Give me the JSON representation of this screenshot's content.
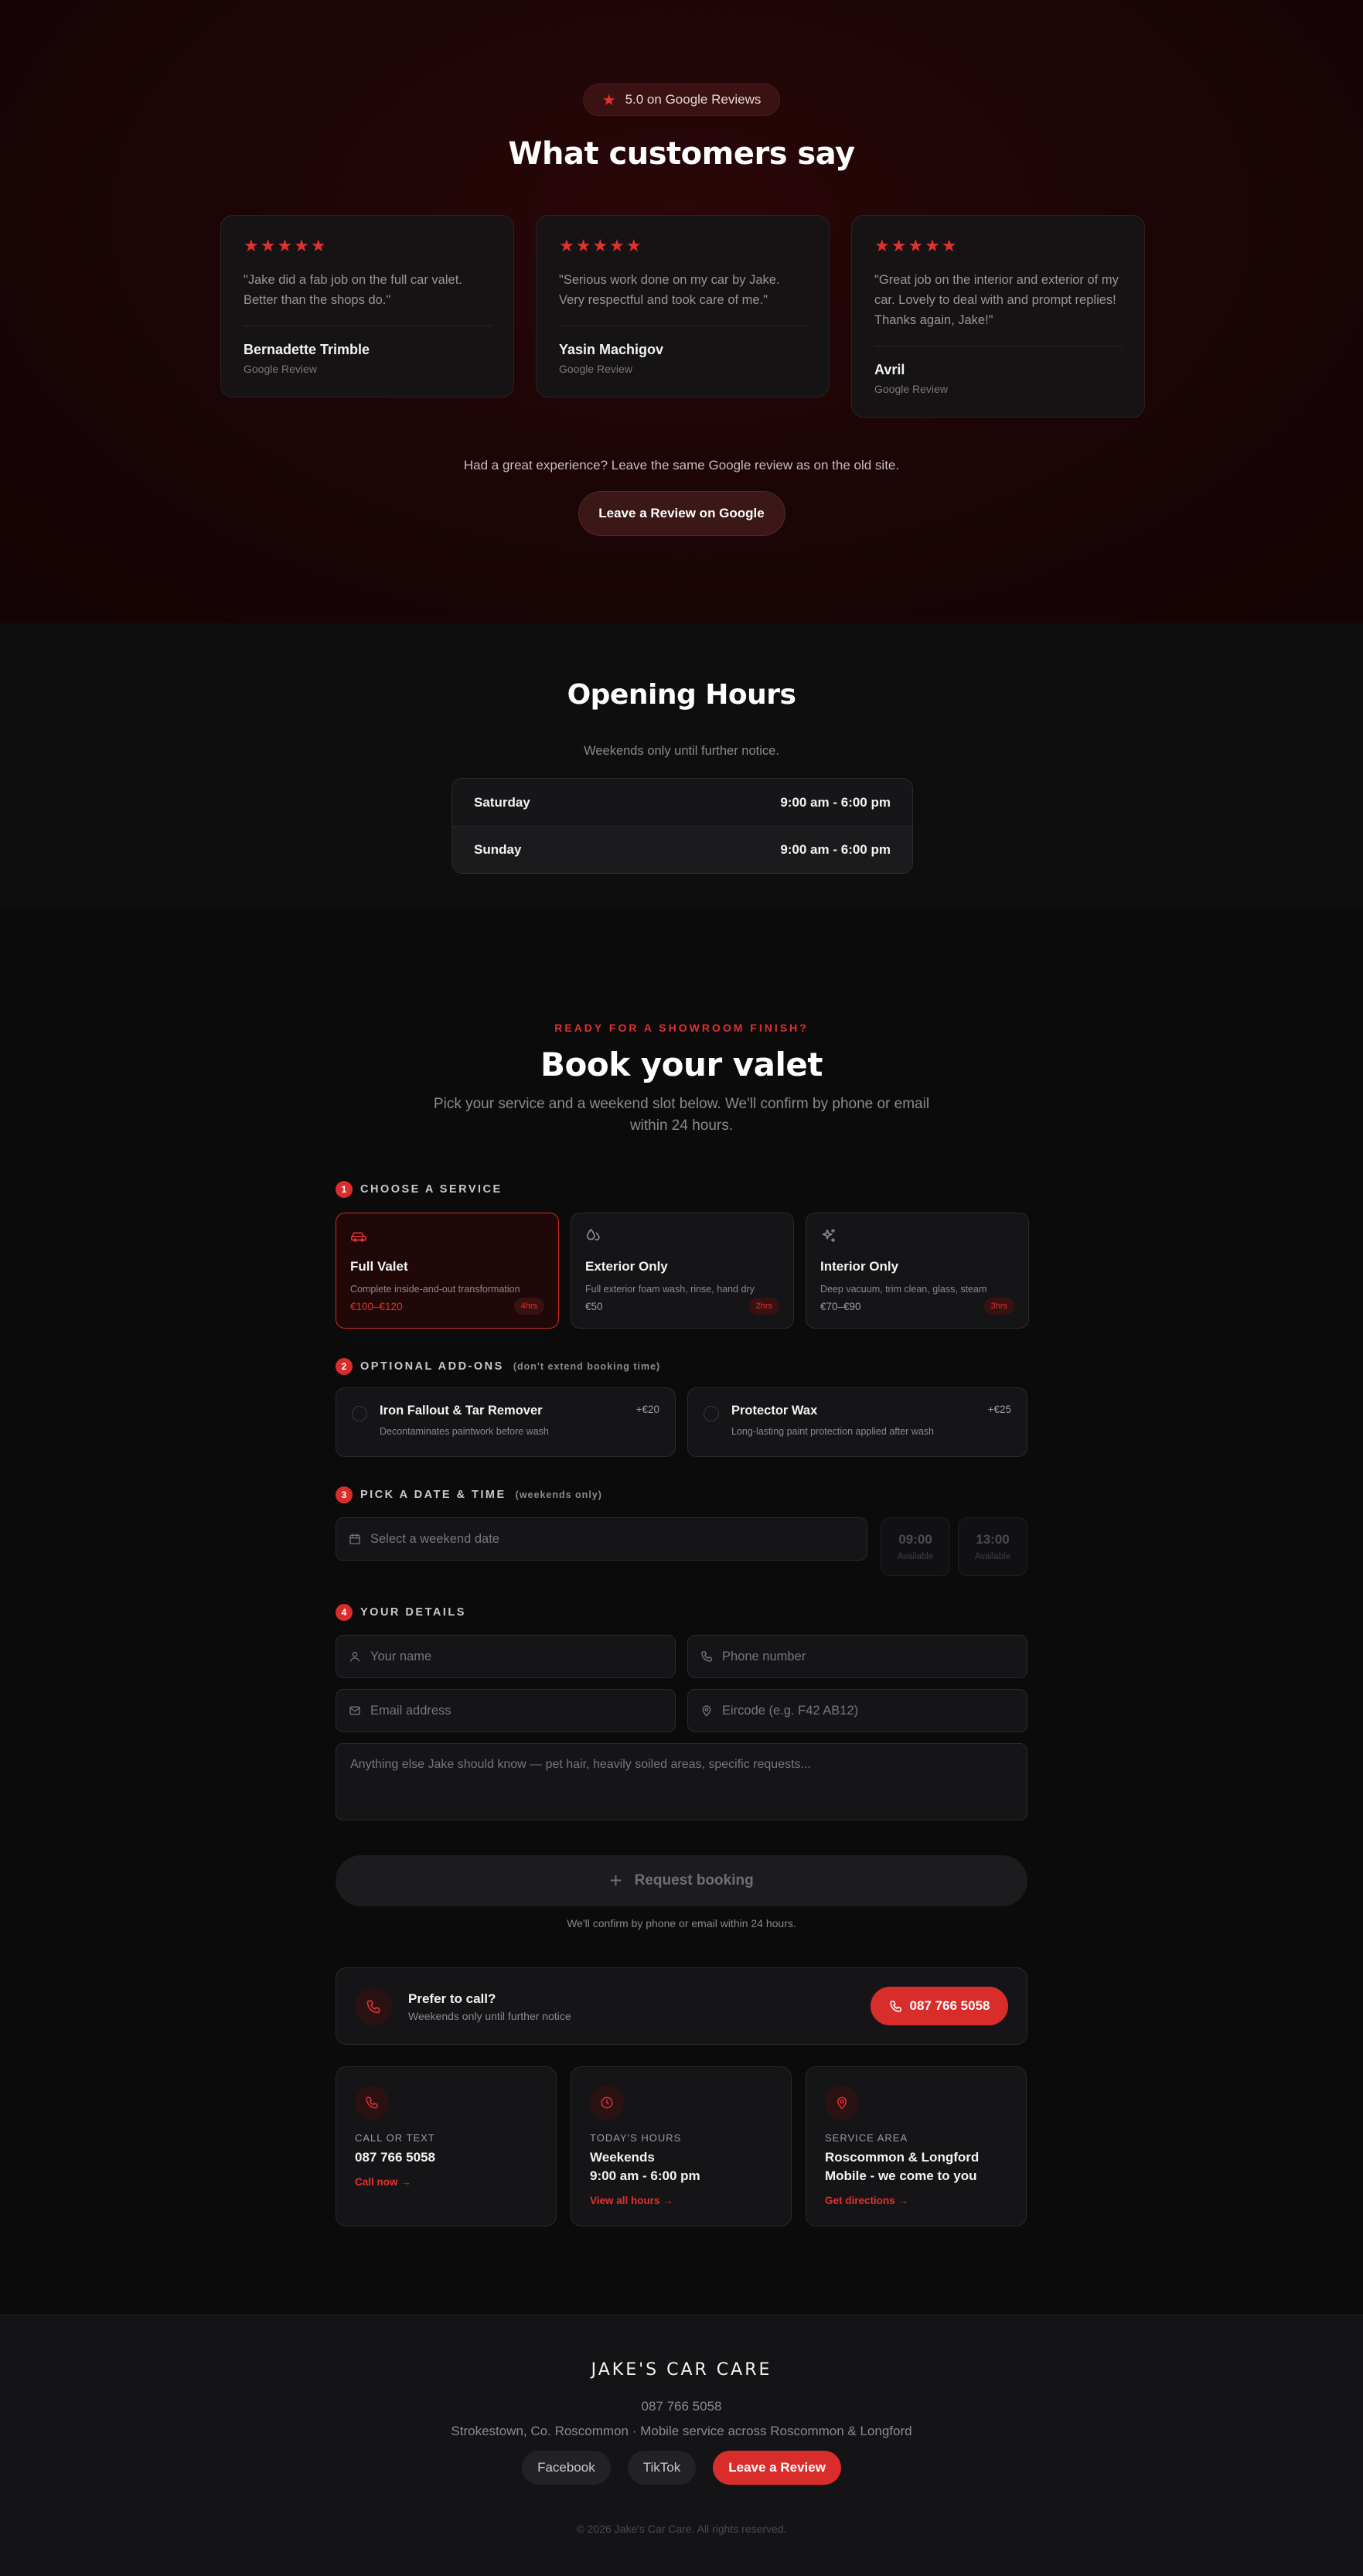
{
  "reviews": {
    "rating_badge": "5.0 on Google Reviews",
    "title": "What customers say",
    "items": [
      {
        "stars": "★★★★★",
        "quote": "\"Jake did a fab job on the full car valet. Better than the shops do.\"",
        "author": "Bernadette Trimble",
        "source": "Google Review"
      },
      {
        "stars": "★★★★★",
        "quote": "\"Serious work done on my car by Jake. Very respectful and took care of me.\"",
        "author": "Yasin Machigov",
        "source": "Google Review"
      },
      {
        "stars": "★★★★★",
        "quote": "\"Great job on the interior and exterior of my car. Lovely to deal with and prompt replies! Thanks again, Jake!\"",
        "author": "Avril",
        "source": "Google Review"
      }
    ],
    "cta_text": "Had a great experience? Leave the same Google review as on the old site.",
    "cta_button": "Leave a Review on Google"
  },
  "hours": {
    "title": "Opening Hours",
    "subtitle": "Weekends only until further notice.",
    "rows": [
      {
        "day": "Saturday",
        "time": "9:00 am - 6:00 pm"
      },
      {
        "day": "Sunday",
        "time": "9:00 am - 6:00 pm"
      }
    ]
  },
  "booking": {
    "eyebrow": "READY FOR A SHOWROOM FINISH?",
    "title": "Book your valet",
    "lead_line1": "Pick your service and a weekend slot below. We'll confirm by phone or email",
    "lead_line2": "within 24 hours.",
    "step1": {
      "num": "1",
      "label": "CHOOSE A SERVICE"
    },
    "services": [
      {
        "name": "Full Valet",
        "desc": "Complete inside-and-out transformation",
        "price": "€100–€120",
        "duration": "4hrs",
        "selected": true
      },
      {
        "name": "Exterior Only",
        "desc": "Full exterior foam wash, rinse, hand dry",
        "price": "€50",
        "duration": "2hrs",
        "selected": false
      },
      {
        "name": "Interior Only",
        "desc": "Deep vacuum, trim clean, glass, steam",
        "price": "€70–€90",
        "duration": "3hrs",
        "selected": false
      }
    ],
    "step2": {
      "num": "2",
      "label": "OPTIONAL ADD-ONS",
      "note": "(don't extend booking time)"
    },
    "addons": [
      {
        "name": "Iron Fallout & Tar Remover",
        "desc": "Decontaminates paintwork before wash",
        "price": "+€20"
      },
      {
        "name": "Protector Wax",
        "desc": "Long-lasting paint protection applied after wash",
        "price": "+€25"
      }
    ],
    "step3": {
      "num": "3",
      "label": "PICK A DATE & TIME",
      "note": "(weekends only)"
    },
    "date_placeholder": "Select a weekend date",
    "slots": [
      {
        "time": "09:00",
        "status": "Available"
      },
      {
        "time": "13:00",
        "status": "Available"
      }
    ],
    "step4": {
      "num": "4",
      "label": "YOUR DETAILS"
    },
    "name_placeholder": "Your name",
    "phone_placeholder": "Phone number",
    "email_placeholder": "Email address",
    "eircode_placeholder": "Eircode (e.g. F42 AB12)",
    "notes_placeholder": "Anything else Jake should know — pet hair, heavily soiled areas, specific requests...",
    "submit_label": "Request booking",
    "submit_icon": "+",
    "confirm_note": "We'll confirm by phone or email within 24 hours."
  },
  "call_banner": {
    "title": "Prefer to call?",
    "subtitle": "Weekends only until further notice",
    "button": "087 766 5058"
  },
  "info_cards": [
    {
      "icon": "phone-icon",
      "label": "CALL OR TEXT",
      "value_line1": "087 766 5058",
      "value_line2": "",
      "link": "Call now →"
    },
    {
      "icon": "clock-icon",
      "label": "TODAY'S HOURS",
      "value_line1": "Weekends",
      "value_line2": "9:00 am - 6:00 pm",
      "link": "View all hours →"
    },
    {
      "icon": "map-pin-icon",
      "label": "SERVICE AREA",
      "value_line1": "Roscommon & Longford",
      "value_line2": "Mobile - we come to you",
      "link": "Get directions →"
    }
  ],
  "footer": {
    "brand": "JAKE'S CAR CARE",
    "phone": "087 766 5058",
    "address": "Strokestown, Co. Roscommon · Mobile service across Roscommon & Longford",
    "links": [
      "Facebook",
      "TikTok"
    ],
    "review_button": "Leave a Review",
    "copyright": "© 2026 Jake's Car Care. All rights reserved."
  },
  "colors": {
    "accent": "#d92d2b",
    "background": "#0b0b0c",
    "card": "#151517"
  }
}
